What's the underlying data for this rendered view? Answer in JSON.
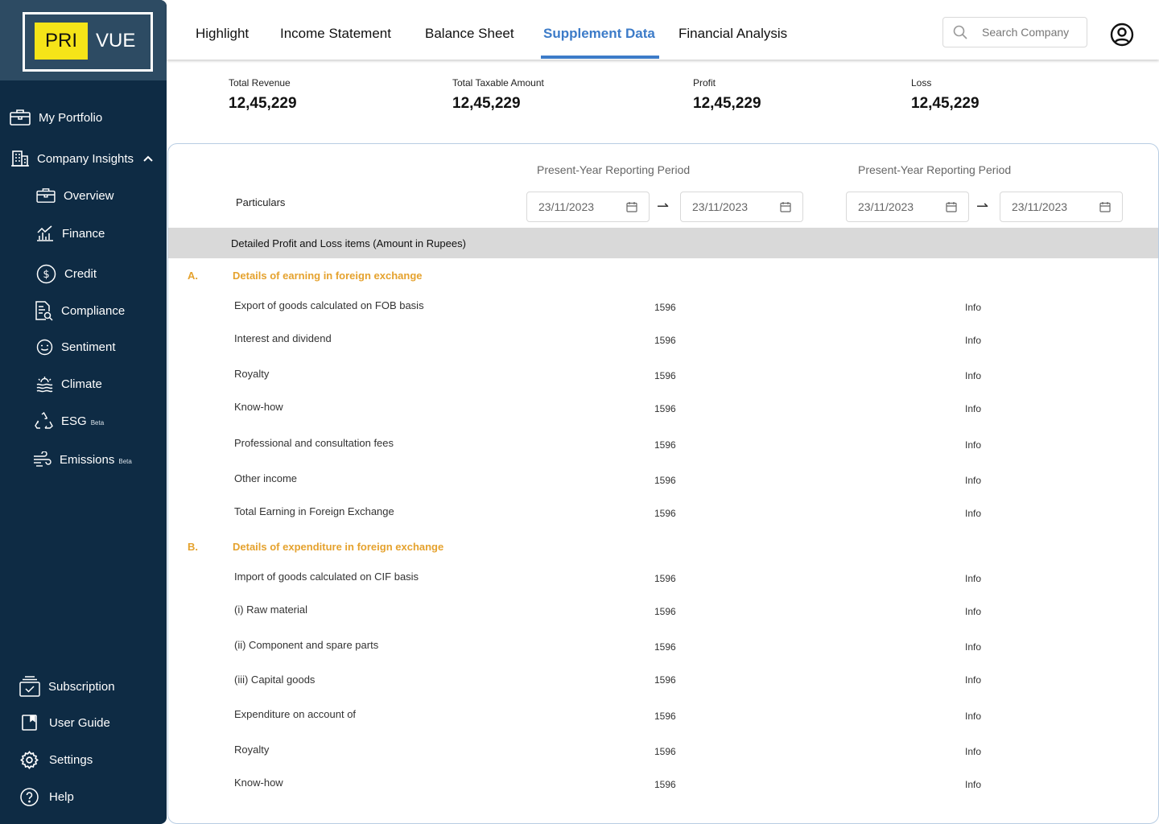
{
  "brand": {
    "left": "PRI",
    "right": "VUE"
  },
  "sidebar": {
    "items": [
      {
        "label": "My Portfolio",
        "icon": "briefcase-icon"
      },
      {
        "label": "Company Insights",
        "icon": "building-icon"
      },
      {
        "label": "Overview",
        "icon": "briefcase-icon"
      },
      {
        "label": "Finance",
        "icon": "finance-chart-icon"
      },
      {
        "label": "Credit",
        "icon": "dollar-circle-icon"
      },
      {
        "label": "Compliance",
        "icon": "document-search-icon"
      },
      {
        "label": "Sentiment",
        "icon": "smiley-icon"
      },
      {
        "label": "Climate",
        "icon": "climate-icon"
      },
      {
        "label": "ESG",
        "icon": "recycle-icon",
        "badge": "Beta"
      },
      {
        "label": "Emissions",
        "icon": "wind-icon",
        "badge": "Beta"
      }
    ],
    "bottom": [
      {
        "label": "Subscription",
        "icon": "subscription-icon"
      },
      {
        "label": "User Guide",
        "icon": "book-icon"
      },
      {
        "label": "Settings",
        "icon": "gear-icon"
      },
      {
        "label": "Help",
        "icon": "help-circle-icon"
      }
    ]
  },
  "tabs": [
    {
      "label": "Highlight"
    },
    {
      "label": "Income Statement"
    },
    {
      "label": "Balance Sheet"
    },
    {
      "label": "Supplement Data",
      "active": true
    },
    {
      "label": "Financial Analysis"
    }
  ],
  "search": {
    "placeholder": "Search Company"
  },
  "kpis": [
    {
      "label": "Total Revenue",
      "value": "12,45,229"
    },
    {
      "label": "Total Taxable Amount",
      "value": "12,45,229"
    },
    {
      "label": "Profit",
      "value": "12,45,229"
    },
    {
      "label": "Loss",
      "value": "12,45,229"
    }
  ],
  "table": {
    "period_title_1": "Present-Year Reporting Period",
    "period_title_2": "Present-Year Reporting Period",
    "particulars_label": "Particulars",
    "dates": [
      "23/11/2023",
      "23/11/2023",
      "23/11/2023",
      "23/11/2023"
    ],
    "arrow": "⇀",
    "section_title": "Detailed Profit and Loss items (Amount in Rupees)",
    "groups": [
      {
        "letter": "A.",
        "title": "Details of earning in foreign exchange",
        "rows": [
          {
            "label": "Export of goods calculated on FOB basis",
            "value": "1596",
            "info": "Info"
          },
          {
            "label": "Interest and dividend",
            "value": "1596",
            "info": "Info"
          },
          {
            "label": "Royalty",
            "value": "1596",
            "info": "Info"
          },
          {
            "label": "Know-how",
            "value": "1596",
            "info": "Info"
          },
          {
            "label": "Professional and consultation fees",
            "value": "1596",
            "info": "Info"
          },
          {
            "label": "Other income",
            "value": "1596",
            "info": "Info"
          },
          {
            "label": "Total Earning in Foreign Exchange",
            "value": "1596",
            "info": "Info"
          }
        ]
      },
      {
        "letter": "B.",
        "title": "Details of expenditure in foreign exchange",
        "rows": [
          {
            "label": "Import of goods calculated on CIF basis",
            "value": "1596",
            "info": "Info"
          },
          {
            "label": "(i) Raw material",
            "value": "1596",
            "info": "Info"
          },
          {
            "label": "(ii) Component and spare parts",
            "value": "1596",
            "info": "Info"
          },
          {
            "label": "(iii) Capital goods",
            "value": "1596",
            "info": "Info"
          },
          {
            "label": "Expenditure on account of",
            "value": "1596",
            "info": "Info"
          },
          {
            "label": "Royalty",
            "value": "1596",
            "info": "Info"
          },
          {
            "label": "Know-how",
            "value": "1596",
            "info": "Info"
          }
        ]
      }
    ]
  },
  "colors": {
    "sidebar": "#0e2b44",
    "accent": "#3c7bc8",
    "group_title": "#e5a22e",
    "logo_yellow": "#f5e418"
  }
}
